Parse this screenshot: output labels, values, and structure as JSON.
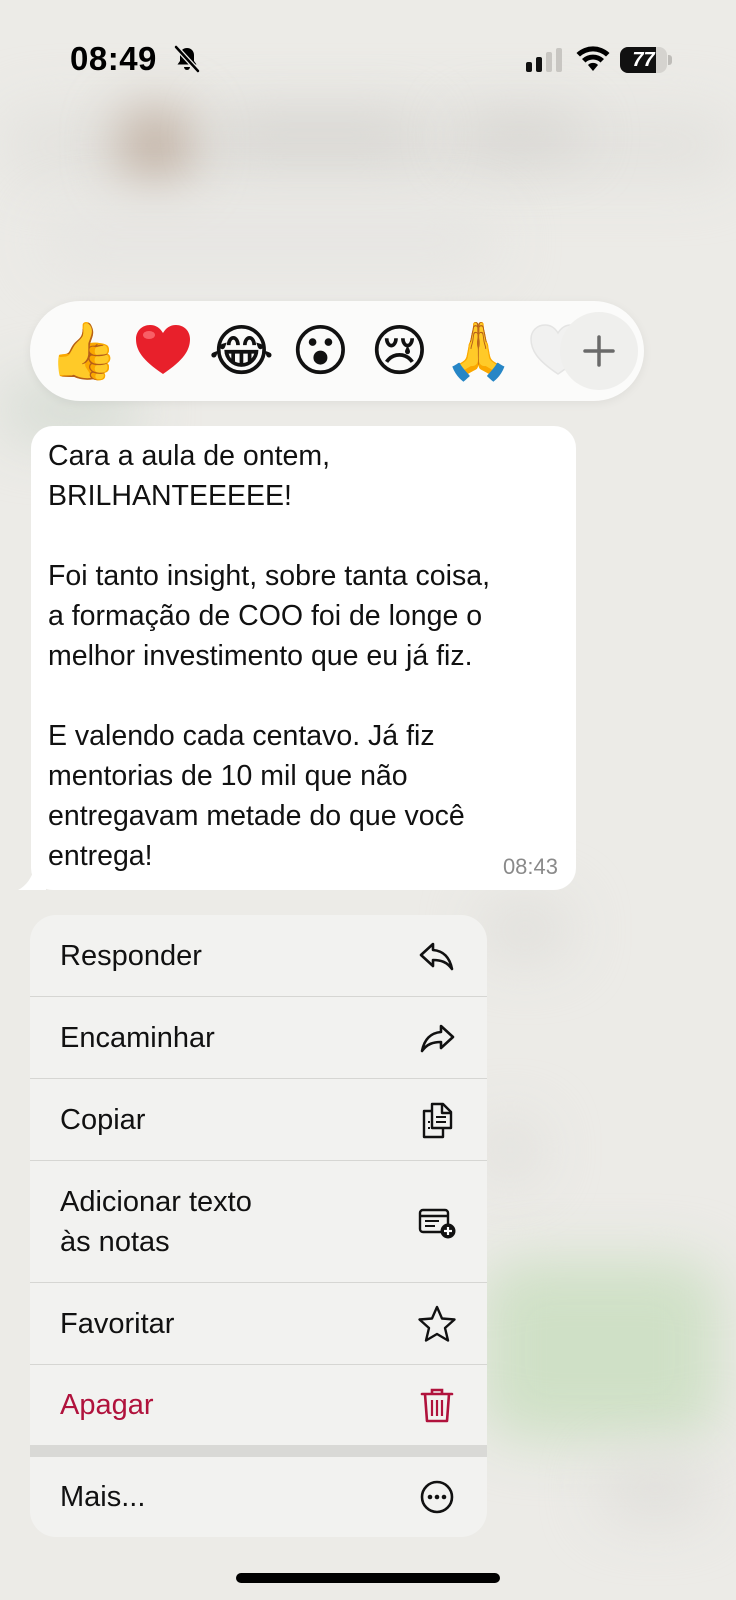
{
  "status_bar": {
    "time": "08:49",
    "battery_percent": "77",
    "battery_level": 0.77
  },
  "reactions": {
    "items": [
      {
        "name": "thumbs-up",
        "glyph": "👍"
      },
      {
        "name": "red-heart",
        "glyph": "❤️"
      },
      {
        "name": "tears-of-joy",
        "glyph": "😂"
      },
      {
        "name": "surprised",
        "glyph": "😮"
      },
      {
        "name": "crying",
        "glyph": "😢"
      },
      {
        "name": "folded-hands",
        "glyph": "🙏"
      }
    ],
    "more_icon": "plus-icon"
  },
  "message": {
    "text": "Cara a aula de ontem,\nBRILHANTEEEEE!\n\nFoi tanto insight, sobre tanta coisa,\na formação de COO foi de longe o\nmelhor investimento que eu já fiz.\n\nE valendo cada centavo. Já fiz\nmentorias de 10 mil que não\nentregavam metade do que você\nentrega!",
    "time": "08:43"
  },
  "menu": {
    "reply": {
      "label": "Responder",
      "icon": "reply-icon"
    },
    "forward": {
      "label": "Encaminhar",
      "icon": "forward-icon"
    },
    "copy": {
      "label": "Copiar",
      "icon": "copy-icon"
    },
    "add_note": {
      "label": "Adicionar texto\nàs notas",
      "icon": "add-note-icon"
    },
    "star": {
      "label": "Favoritar",
      "icon": "star-icon"
    },
    "delete": {
      "label": "Apagar",
      "icon": "trash-icon"
    },
    "more": {
      "label": "Mais...",
      "icon": "more-icon"
    }
  },
  "colors": {
    "danger": "#b0123c",
    "bubble": "#ffffff",
    "menu_background": "#f2f2f0",
    "background": "#ecebe7"
  }
}
